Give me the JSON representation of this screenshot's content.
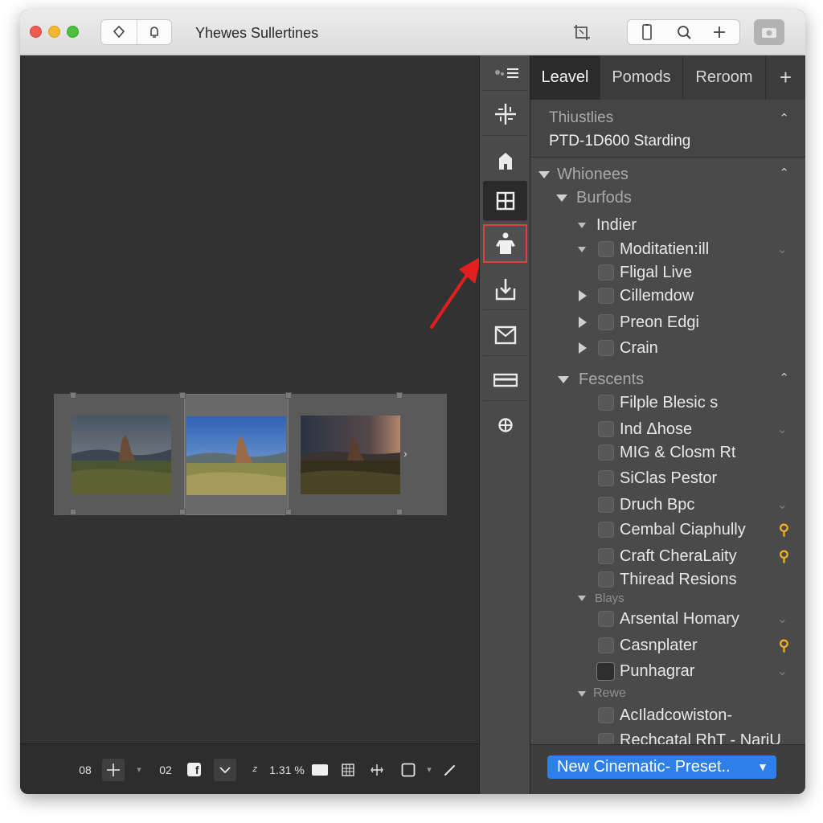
{
  "window": {
    "title": "Yhewes Sullertines"
  },
  "panel": {
    "tabs": [
      {
        "label": "Leavel",
        "active": true
      },
      {
        "label": "Pomods",
        "active": false
      },
      {
        "label": "Reroom",
        "active": false
      }
    ],
    "add_tab_label": "+",
    "info": {
      "label": "Thiustlies",
      "value": "PTD-1D600 Starding"
    },
    "tree": {
      "root": "Whionees",
      "group1": "Burfods",
      "group1_sub": "Indier",
      "items1": [
        "Moditatien:ill",
        "Fligal Live",
        "Cillemdow",
        "Preon Edgi",
        "Crain"
      ],
      "group2": "Fescents",
      "items2": [
        "Filple Blesic s",
        "Ind Δhose",
        "MIG & Closm Rt",
        "SiClas Pestor",
        "Druch Bpc",
        "Cembal Ciaphully",
        "Craft CheraLaity",
        "Thiread Resions"
      ],
      "group3": "Blays",
      "items3": [
        "Arsental Homary",
        "Casnplater",
        "Punhagrar"
      ],
      "group4": "Rewe",
      "items4": [
        "AcIladcowiston-",
        "Rechcatal RhT - NariU"
      ]
    },
    "preset_label": "New Cinematic- Preset.."
  },
  "bottombar": {
    "count_a": "08",
    "count_b": "02",
    "zoom": "1.31 %"
  },
  "colors": {
    "accent": "#2f7fe8",
    "highlight": "#e0423a",
    "warning": "#f2b21b"
  }
}
